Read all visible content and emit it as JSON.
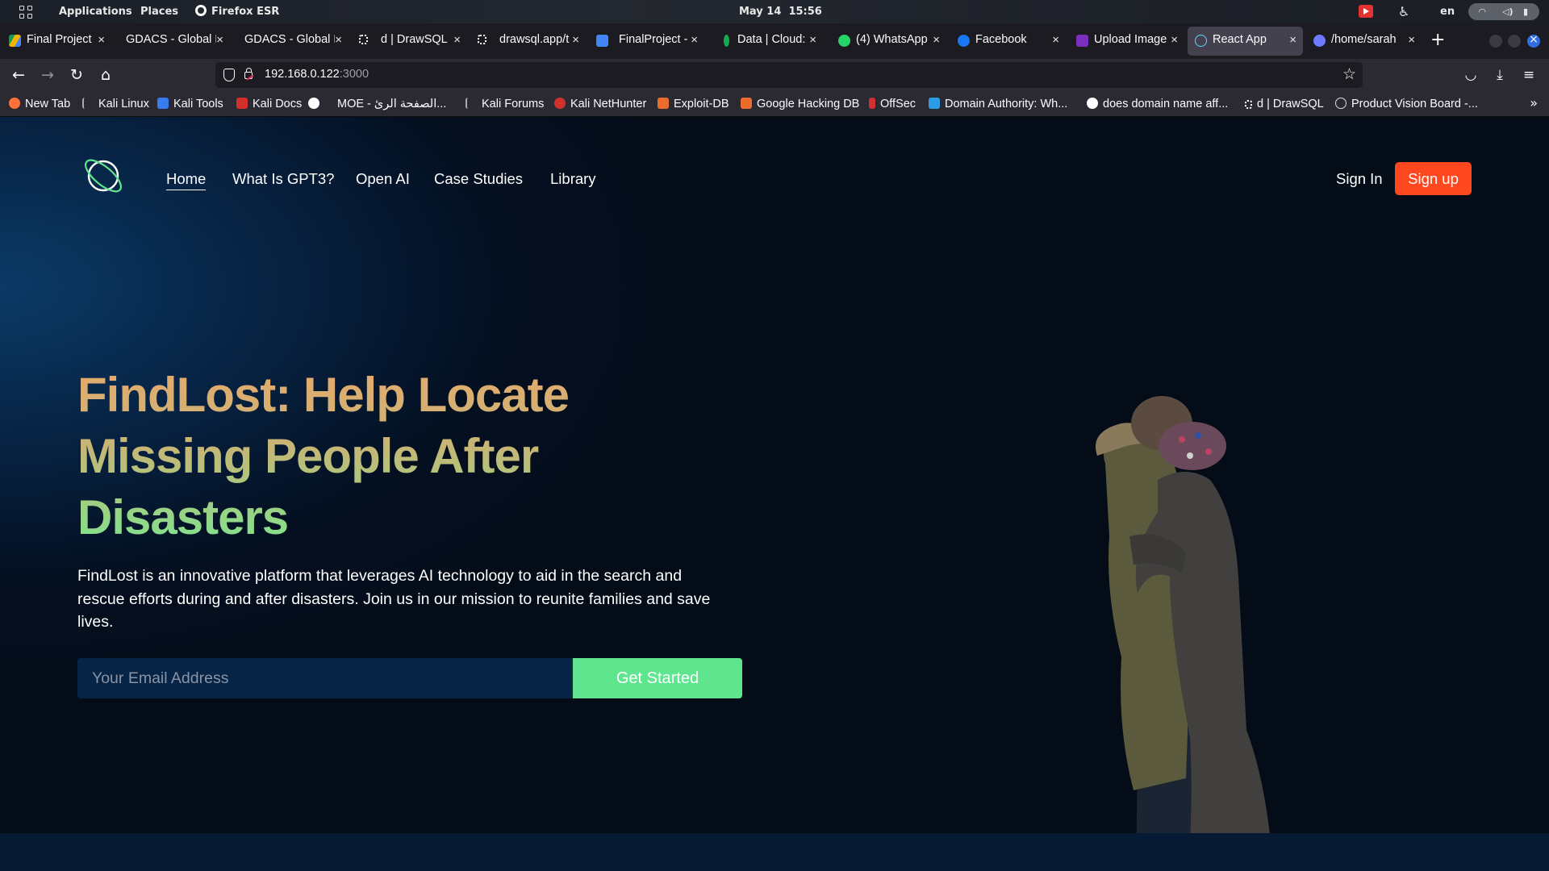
{
  "system_bar": {
    "applications": "Applications",
    "places": "Places",
    "active_app": "Firefox ESR",
    "date": "May 14",
    "time": "15:56",
    "language": "en"
  },
  "tabs": [
    {
      "label": "Final Project",
      "favicon_color": "#f4b400"
    },
    {
      "label": "GDACS - Global D",
      "favicon_color": ""
    },
    {
      "label": "GDACS - Global D",
      "favicon_color": ""
    },
    {
      "label": "d | DrawSQL",
      "favicon_color": "#ffffff"
    },
    {
      "label": "drawsql.app/t",
      "favicon_color": "#ffffff"
    },
    {
      "label": "FinalProject -",
      "favicon_color": "#4285f4"
    },
    {
      "label": "Data | Cloud:",
      "favicon_color": "#13aa52"
    },
    {
      "label": "(4) WhatsApp",
      "favicon_color": "#25d366"
    },
    {
      "label": "Facebook",
      "favicon_color": "#1877f2"
    },
    {
      "label": "Upload Image",
      "favicon_color": "#7b2fbe"
    },
    {
      "label": "React App",
      "favicon_color": "#61dafb"
    },
    {
      "label": "/home/sarah",
      "favicon_color": "#6c7bff"
    }
  ],
  "url": {
    "host": "192.168.0.122",
    "port": ":3000"
  },
  "bookmarks": [
    {
      "label": "New Tab",
      "favicon_color": "#ff7139"
    },
    {
      "label": "Kali Linux",
      "favicon_color": "#367bf0"
    },
    {
      "label": "Kali Tools",
      "favicon_color": "#367bf0"
    },
    {
      "label": "Kali Docs",
      "favicon_color": "#d22f2f"
    },
    {
      "label": "",
      "favicon_color": "#ffffff"
    },
    {
      "label": "MOE - الصفحة الرئ...",
      "favicon_color": ""
    },
    {
      "label": "Kali Forums",
      "favicon_color": "#777777"
    },
    {
      "label": "Kali NetHunter",
      "favicon_color": "#d22f2f"
    },
    {
      "label": "Exploit-DB",
      "favicon_color": "#ec6d2b"
    },
    {
      "label": "Google Hacking DB",
      "favicon_color": "#ec6d2b"
    },
    {
      "label": "OffSec",
      "favicon_color": "#d22f2f"
    },
    {
      "label": "Domain Authority: Wh...",
      "favicon_color": "#2c9ce6"
    },
    {
      "label": "does domain name aff...",
      "favicon_color": "#ffffff"
    },
    {
      "label": "d | DrawSQL",
      "favicon_color": "#ffffff"
    },
    {
      "label": "Product Vision Board -...",
      "favicon_color": "#cccccc"
    }
  ],
  "site": {
    "nav": [
      "Home",
      "What Is GPT3?",
      "Open AI",
      "Case Studies",
      "Library"
    ],
    "sign_in": "Sign In",
    "sign_up": "Sign up",
    "hero": {
      "title": "FindLost: Help Locate Missing People After Disasters",
      "description": "FindLost is an innovative platform that leverages AI technology to aid in the search and rescue efforts during and after disasters. Join us in our mission to reunite families and save lives.",
      "email_placeholder": "Your Email Address",
      "cta": "Get Started"
    },
    "colors": {
      "background": "#040c18",
      "signup_button": "#ff4820",
      "cta_button": "#5fe58e",
      "title_gradient_top": "#e7a96d",
      "title_gradient_bottom": "#7fe48e"
    }
  }
}
